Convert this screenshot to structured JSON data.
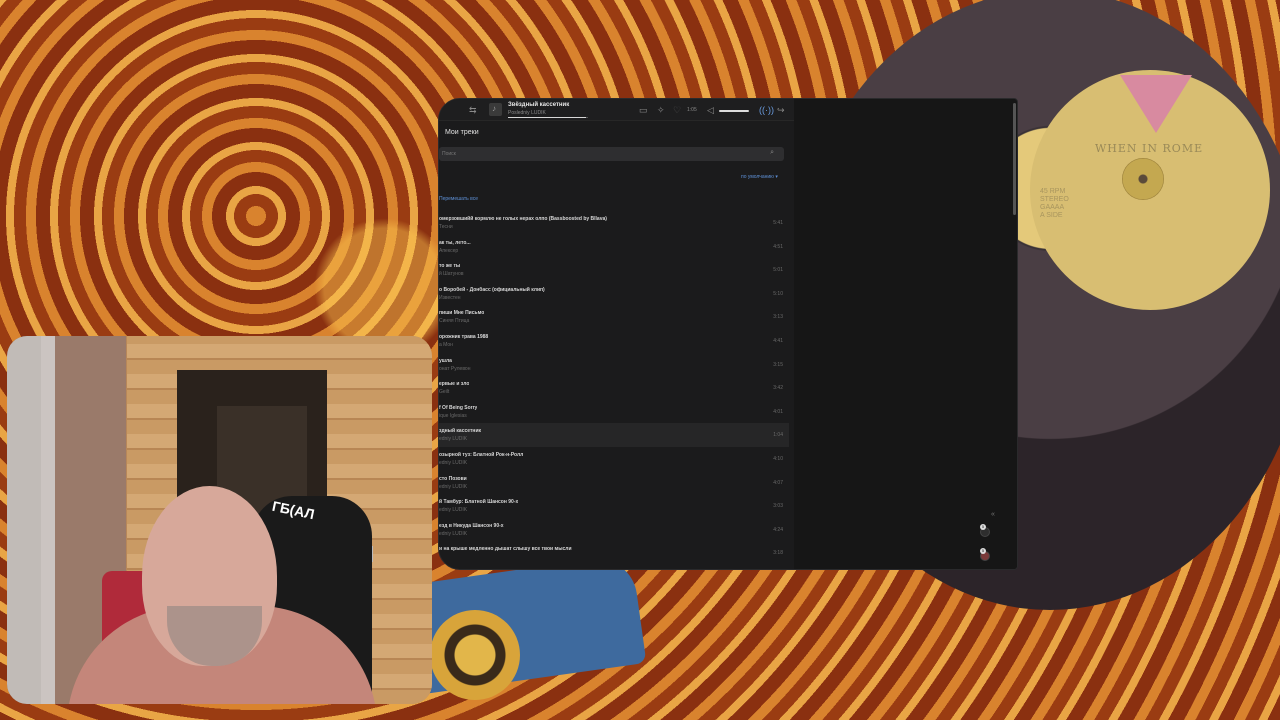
{
  "background": {
    "vinyl_label_title": "WHEN IN ROME",
    "vinyl_label_speed": "45 RPM\nSTEREO\nGAAAA\nA SIDE"
  },
  "player": {
    "now_playing_title": "Звёздный кассетник",
    "now_playing_artist": "Posledniy LUDIK",
    "progress": 0.98,
    "time": "1:05",
    "volume": 1.0,
    "icons": [
      "back-icon",
      "music-note-icon",
      "lyrics-icon",
      "shuffle-icon",
      "heart-icon",
      "volume-icon",
      "broadcast-icon",
      "share-icon"
    ]
  },
  "page": {
    "title": "Мои треки",
    "search_placeholder": "Поиск",
    "sort_label": "по умолчанию ▾",
    "shuffle_label": "Перемешать все"
  },
  "tracks": [
    {
      "title": "омерзовшийй кормлю не голых нерах олпо (Bassboosted by Bllava)",
      "artist": "Тесни",
      "duration": "5:41",
      "active": false
    },
    {
      "title": "ак ты, лето...",
      "artist": "Апексер",
      "duration": "4:51",
      "active": false
    },
    {
      "title": "то же ты",
      "artist": "й Шатунов",
      "duration": "5:01",
      "active": false
    },
    {
      "title": "о Воробей - Донбасс (официальный клип)",
      "artist": "Известен",
      "duration": "5:10",
      "active": false
    },
    {
      "title": "пиши Мне Письмо",
      "artist": "Синяя Птица",
      "duration": "3:13",
      "active": false
    },
    {
      "title": "орожник трава 1988",
      "artist": "а Мон",
      "duration": "4:41",
      "active": false
    },
    {
      "title": "ушла",
      "artist": "онат Рулевон",
      "duration": "3:15",
      "active": false
    },
    {
      "title": "ервые и зло",
      "artist": "Geilt",
      "duration": "3:42",
      "active": false
    },
    {
      "title": "f Of Being Sorry",
      "artist": "ique Iglesias",
      "duration": "4:01",
      "active": false
    },
    {
      "title": "здный кассетник",
      "artist": "edniy LUDIK",
      "duration": "1:04",
      "active": true
    },
    {
      "title": "озырной туз: Блатной Рок-н-Ролл",
      "artist": "edniy LUDIK",
      "duration": "4:10",
      "active": false
    },
    {
      "title": "сто Позови",
      "artist": "edniy LUDIK",
      "duration": "4:07",
      "active": false
    },
    {
      "title": "й Тамбур: Блатной Шансон 90-х",
      "artist": "edniy LUDIK",
      "duration": "3:03",
      "active": false
    },
    {
      "title": "езд в Никуда Шансон 90-х",
      "artist": "edniy LUDIK",
      "duration": "4:24",
      "active": false
    },
    {
      "title": "и на крыше медленно дышат слышу все твои мысли",
      "artist": "",
      "duration": "3:18",
      "active": false
    }
  ],
  "webcam": {
    "chair_text": "ГБ(АЛ"
  }
}
